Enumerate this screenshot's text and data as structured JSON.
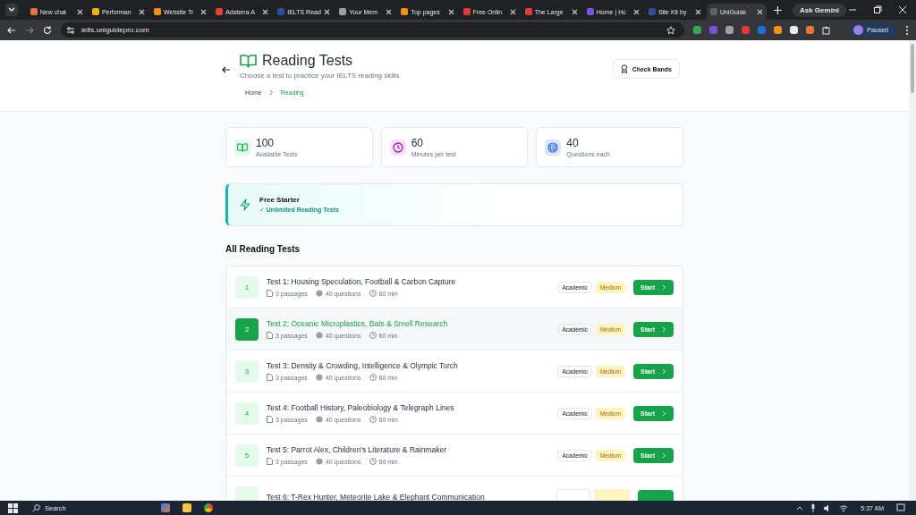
{
  "browser": {
    "tabs": [
      {
        "title": "New chat",
        "color": "#e8743b",
        "selected": false
      },
      {
        "title": "Performan",
        "color": "#f4b400",
        "selected": false
      },
      {
        "title": "Website Tr",
        "color": "#f29111",
        "selected": false
      },
      {
        "title": "Adsterra A",
        "color": "#e2432a",
        "selected": false
      },
      {
        "title": "IELTS Read",
        "color": "#2b4ea2",
        "selected": false
      },
      {
        "title": "Your Mem",
        "color": "#9aa0a6",
        "selected": false
      },
      {
        "title": "Top pages",
        "color": "#f29111",
        "selected": false
      },
      {
        "title": "Free Onlin",
        "color": "#e53935",
        "selected": false
      },
      {
        "title": "The Large",
        "color": "#e53935",
        "selected": false
      },
      {
        "title": "Home | Hc",
        "color": "#7b4fe0",
        "selected": false
      },
      {
        "title": "Site Kit by",
        "color": "#2b4ea2",
        "selected": false
      },
      {
        "title": "UniGuide",
        "color": "#5f6368",
        "selected": true
      }
    ],
    "gemini": "Ask Gemini",
    "url": "ielts.uniguidepro.com",
    "profile": "Paused",
    "extensions": [
      {
        "color": "#34a853"
      },
      {
        "color": "#7b4fe0"
      },
      {
        "color": "#9aa0a6"
      },
      {
        "color": "#e53935"
      },
      {
        "color": "#1e6fd9"
      },
      {
        "color": "#f29111"
      },
      {
        "color": "#e8eaed"
      },
      {
        "color": "#e8743b"
      }
    ]
  },
  "header": {
    "title": "Reading Tests",
    "subtitle": "Choose a test to practice your IELTS reading skills",
    "action": "Check Bands",
    "breadcrumb": [
      {
        "label": "Home",
        "selected": false
      },
      {
        "label": "Reading",
        "selected": true
      }
    ]
  },
  "stats": [
    {
      "kind": "book",
      "value": "100",
      "label": "Available Tests"
    },
    {
      "kind": "clock",
      "value": "60",
      "label": "Minutes per test"
    },
    {
      "kind": "target",
      "value": "40",
      "label": "Questions each"
    }
  ],
  "plan": {
    "title": "Free Starter",
    "feature": "✓ Unlimited Reading Tests"
  },
  "list_title": "All Reading Tests",
  "tests": [
    {
      "kind": "full",
      "number": "1",
      "title": "Test 1: Housing Speculation, Football & Carbon Capture",
      "passages": "3 passages",
      "questions": "40 questions",
      "time": "60 min",
      "type": "Academic",
      "difficulty": "Medium",
      "action": "Start",
      "selected": false
    },
    {
      "kind": "full",
      "number": "2",
      "title": "Test 2: Oceanic Microplastics, Bats & Smell Research",
      "passages": "3 passages",
      "questions": "40 questions",
      "time": "60 min",
      "type": "Academic",
      "difficulty": "Medium",
      "action": "Start",
      "selected": true
    },
    {
      "kind": "full",
      "number": "3",
      "title": "Test 3: Density & Crowding, Intelligence & Olympic Torch",
      "passages": "3 passages",
      "questions": "40 questions",
      "time": "60 min",
      "type": "Academic",
      "difficulty": "Medium",
      "action": "Start",
      "selected": false
    },
    {
      "kind": "full",
      "number": "4",
      "title": "Test 4: Football History, Paleobiology & Telegraph Lines",
      "passages": "3 passages",
      "questions": "40 questions",
      "time": "60 min",
      "type": "Academic",
      "difficulty": "Medium",
      "action": "Start",
      "selected": false
    },
    {
      "kind": "full",
      "number": "5",
      "title": "Test 5: Parrot Alex, Children's Literature & Rainmaker",
      "passages": "3 passages",
      "questions": "40 questions",
      "time": "60 min",
      "type": "Academic",
      "difficulty": "Medium",
      "action": "Start",
      "selected": false
    },
    {
      "kind": "cut",
      "title": "Test 6: T-Rex Hunter, Meteorite Lake & Elephant Communication",
      "selected": false
    }
  ],
  "taskbar": {
    "search": "Search",
    "time": "5:37 AM"
  }
}
